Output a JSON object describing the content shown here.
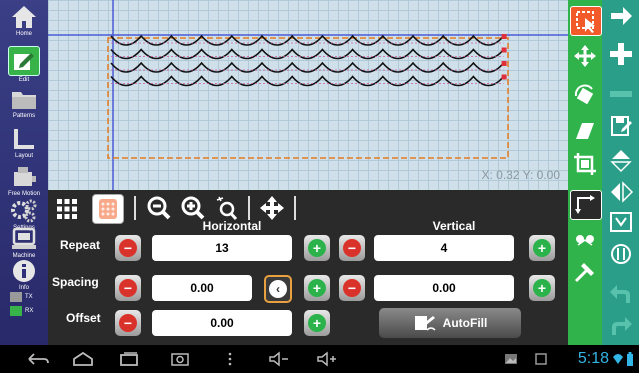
{
  "sidebar": {
    "items": [
      {
        "label": "Home",
        "icon": "home-icon"
      },
      {
        "label": "Edit",
        "icon": "edit-icon",
        "active": true
      },
      {
        "label": "Patterns",
        "icon": "folder-icon"
      },
      {
        "label": "Layout",
        "icon": "layout-icon"
      },
      {
        "label": "Free Motion",
        "icon": "free-motion-icon"
      },
      {
        "label": "Settings",
        "icon": "settings-icon"
      },
      {
        "label": "Machine",
        "icon": "machine-icon"
      },
      {
        "label": "Info",
        "icon": "info-icon"
      }
    ],
    "indicators": [
      {
        "label": "TX",
        "color": "#9a9a9a"
      },
      {
        "label": "RX",
        "color": "#37b34a"
      }
    ]
  },
  "canvas": {
    "coord_text": "X: 0.32 Y: 0.00"
  },
  "panel": {
    "horizontal_label": "Horizontal",
    "vertical_label": "Vertical",
    "rows": [
      {
        "label": "Repeat",
        "horizontal": "13",
        "vertical": "4"
      },
      {
        "label": "Spacing",
        "horizontal": "0.00",
        "vertical": "0.00"
      },
      {
        "label": "Offset",
        "horizontal": "0.00"
      }
    ],
    "autofill_label": "AutoFill"
  },
  "statusbar": {
    "time": "5:18"
  },
  "colors": {
    "accent_green": "#37b34a",
    "minus_red": "#d9322b",
    "canvas_bg": "#cfe0ea",
    "sidebar_blue": "#2e3179",
    "teal": "#2b9e89",
    "clock_blue": "#33b5e5"
  }
}
